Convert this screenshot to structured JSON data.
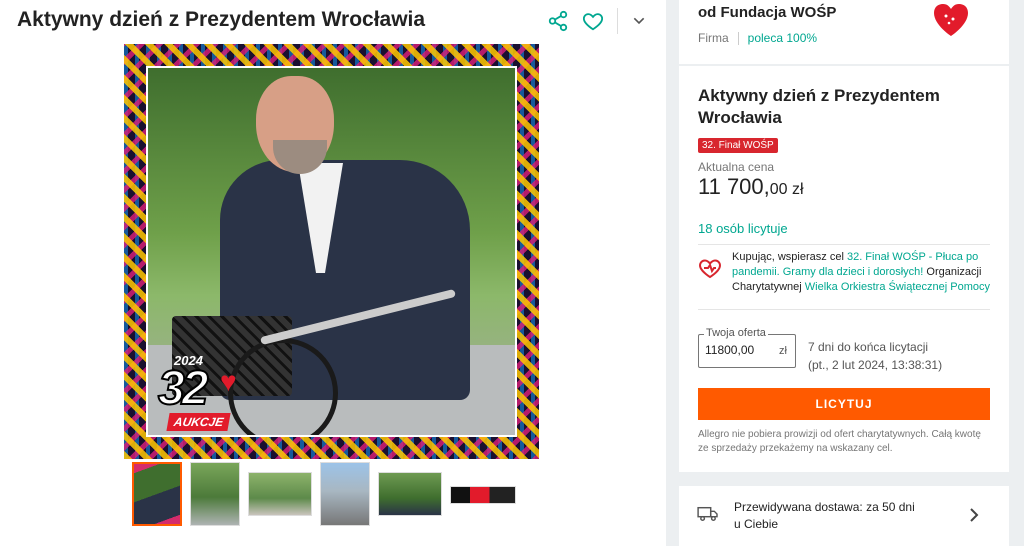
{
  "header": {
    "title": "Aktywny dzień z Prezydentem Wrocławia"
  },
  "gallery": {
    "badge": {
      "year": "2024",
      "number": "32",
      "label": "AUKCJE"
    },
    "thumbnail_count": 6
  },
  "seller": {
    "name": "od Fundacja WOŚP",
    "type": "Firma",
    "recommend": "poleca 100%"
  },
  "offer": {
    "title": "Aktywny dzień z Prezydentem Wrocławia",
    "badge": "32. Finał WOŚP",
    "price_label": "Aktualna cena",
    "price_main": "11 700,",
    "price_decimal": "00 zł",
    "bidders": "18 osób licytuje",
    "charity_prefix": "Kupując, wspierasz cel ",
    "charity_goal": "32. Finał WOŚP - Płuca po pandemii. Gramy dla dzieci i dorosłych!",
    "charity_org_prefix": " Organizacji Charytatywnej ",
    "charity_org": "Wielka Orkiestra Świątecznej Pomocy",
    "bid_label": "Twoja oferta",
    "bid_value": "11800,00",
    "bid_currency": "zł",
    "time_left": "7 dni do końca licytacji",
    "end_date": "(pt., 2 lut 2024, 13:38:31)",
    "bid_button": "LICYTUJ",
    "note": "Allegro nie pobiera prowizji od ofert charytatywnych. Całą kwotę ze sprzedaży przekażemy na wskazany cel."
  },
  "delivery": {
    "line1": "Przewidywana dostawa: za 50 dni",
    "line2": "u Ciebie"
  },
  "colors": {
    "accent": "#ff5a00",
    "link": "#00a790",
    "badge_red": "#d8262e"
  },
  "icons": {
    "share": "share-icon",
    "favorite": "heart-icon",
    "more": "chevron-down-icon",
    "charity": "charity-heart-icon",
    "delivery": "truck-icon",
    "expand": "chevron-right-icon"
  }
}
